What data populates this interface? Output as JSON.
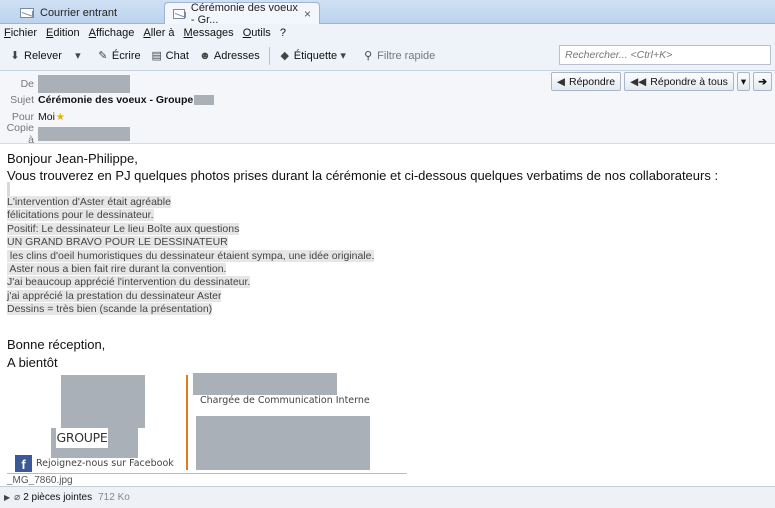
{
  "tabs": [
    {
      "label": "Courrier entrant"
    },
    {
      "label": "Cérémonie des voeux - Gr...",
      "close": "×"
    }
  ],
  "menu": [
    "Fichier",
    "Edition",
    "Affichage",
    "Aller à",
    "Messages",
    "Outils",
    "?"
  ],
  "toolbar": {
    "relever": "Relever",
    "ecrire": "Écrire",
    "chat": "Chat",
    "adresses": "Adresses",
    "etiquette": "Étiquette",
    "filtre": "Filtre rapide",
    "search_placeholder": "Rechercher... <Ctrl+K>"
  },
  "header": {
    "de_label": "De",
    "sujet_label": "Sujet",
    "sujet_value": "Cérémonie des voeux - Groupe",
    "pour_label": "Pour",
    "pour_value": "Moi",
    "copie_label": "Copie à",
    "repondre": "Répondre",
    "repondre_tous": "Répondre à tous"
  },
  "body": {
    "greeting": "Bonjour Jean-Philippe,",
    "intro": "Vous trouverez en PJ quelques photos prises durant la cérémonie et ci-dessous quelques verbatims de nos collaborateurs :",
    "verbatims": [
      "L'intervention d'Aster était agréable",
      "félicitations pour le dessinateur.",
      "Positif: Le dessinateur Le lieu Boîte aux questions",
      "UN GRAND BRAVO POUR LE DESSINATEUR",
      " les clins d'oeil humoristiques du dessinateur étaient sympa, une idée originale.",
      " Aster nous a bien fait rire durant la convention.",
      "J'ai beaucoup apprécié l'intervention du dessinateur.",
      "j'ai apprécié la prestation du dessinateur Aster",
      "Dessins = très bien (scande la présentation)"
    ],
    "closing1": "Bonne réception,",
    "closing2": "A bientôt"
  },
  "signature": {
    "groupe": "GROUPE",
    "role": "Chargée de Communication Interne",
    "facebook": "Rejoignez-nous sur Facebook",
    "facebook_icon": "f"
  },
  "attachment_preview": "_MG_7860.jpg",
  "attachments": {
    "count_label": "2 pièces jointes",
    "size": "712 Ko"
  },
  "colors": {
    "accent_line": "#e07a1a",
    "facebook": "#3b5998"
  }
}
